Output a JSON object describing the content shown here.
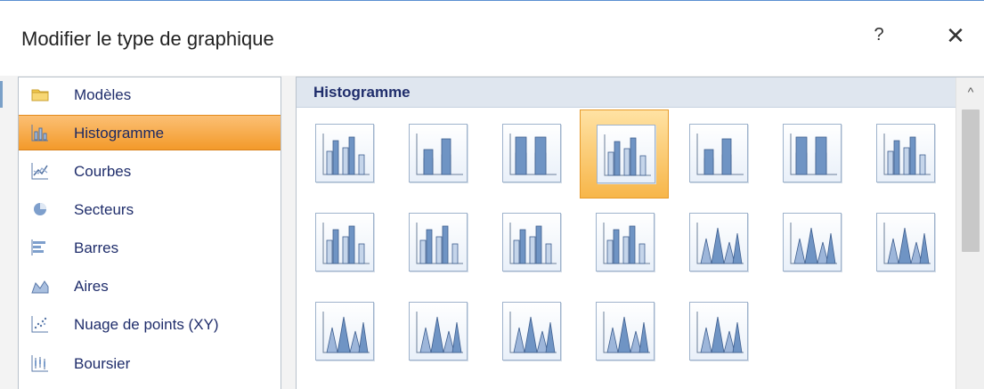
{
  "dialog": {
    "title": "Modifier le type de graphique",
    "help_label": "?",
    "close_label": "✕"
  },
  "sidebar": {
    "items": [
      {
        "label": "Modèles",
        "icon": "folder-icon"
      },
      {
        "label": "Histogramme",
        "icon": "column-chart-icon",
        "selected": true
      },
      {
        "label": "Courbes",
        "icon": "line-chart-icon"
      },
      {
        "label": "Secteurs",
        "icon": "pie-chart-icon"
      },
      {
        "label": "Barres",
        "icon": "bar-chart-icon"
      },
      {
        "label": "Aires",
        "icon": "area-chart-icon"
      },
      {
        "label": "Nuage de points (XY)",
        "icon": "scatter-chart-icon"
      },
      {
        "label": "Boursier",
        "icon": "stock-chart-icon"
      }
    ]
  },
  "gallery": {
    "section_title": "Histogramme",
    "scroll_up_label": "^",
    "tiles": [
      {
        "icon": "clustered-column-icon"
      },
      {
        "icon": "stacked-column-icon"
      },
      {
        "icon": "100-stacked-column-icon"
      },
      {
        "icon": "3d-clustered-column-icon",
        "selected": true
      },
      {
        "icon": "3d-stacked-column-icon"
      },
      {
        "icon": "3d-100-stacked-column-icon"
      },
      {
        "icon": "3d-column-icon"
      },
      {
        "icon": "clustered-cylinder-icon"
      },
      {
        "icon": "stacked-cylinder-icon"
      },
      {
        "icon": "100-stacked-cylinder-icon"
      },
      {
        "icon": "3d-cylinder-icon"
      },
      {
        "icon": "clustered-cone-icon"
      },
      {
        "icon": "stacked-cone-icon"
      },
      {
        "icon": "100-stacked-cone-icon"
      },
      {
        "icon": "3d-cone-icon"
      },
      {
        "icon": "clustered-pyramid-icon"
      },
      {
        "icon": "stacked-pyramid-icon"
      },
      {
        "icon": "100-stacked-pyramid-icon"
      },
      {
        "icon": "3d-pyramid-icon"
      }
    ]
  },
  "colors": {
    "accent_orange": "#f39a2a",
    "header_blue": "#dfe6ef",
    "label_navy": "#1f2d6b",
    "chart_blue": "#6f94c4"
  }
}
